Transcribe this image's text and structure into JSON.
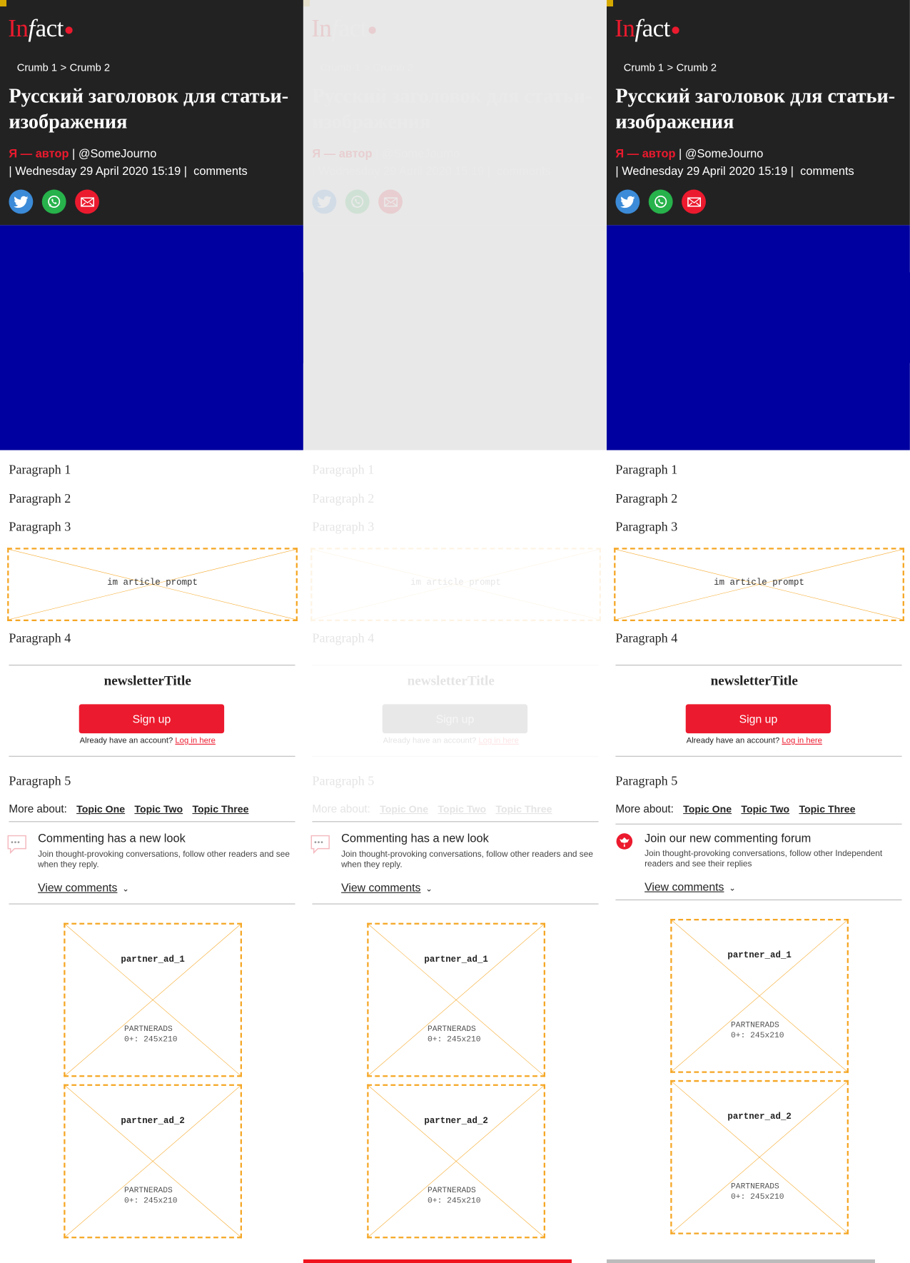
{
  "logo": {
    "in": "In",
    "f": "f",
    "act": "act"
  },
  "breadcrumb": {
    "crumb1": "Crumb 1",
    "sep": ">",
    "crumb2": "Crumb 2"
  },
  "article": {
    "title": "Русский заголовок для статьи-изображения",
    "author": "Я — автор",
    "handle": "@SomeJourno",
    "date": "Wednesday 29 April 2020 15:19",
    "comments_link": "comments",
    "paragraphs": [
      "Paragraph 1",
      "Paragraph 2",
      "Paragraph 3",
      "Paragraph 4",
      "Paragraph 5"
    ]
  },
  "share": {
    "icons": [
      "twitter-icon",
      "whatsapp-icon",
      "email-icon"
    ],
    "colors": {
      "twitter": "#3b8bd8",
      "whatsapp": "#27b24b",
      "email": "#ec1a2e"
    }
  },
  "prompt_slot": {
    "label": "im article prompt"
  },
  "newsletter": {
    "title": "newsletterTitle",
    "signup_label": "Sign up",
    "already": "Already have an account?",
    "login_link": "Log in here"
  },
  "more_about": {
    "label": "More about:",
    "topics": [
      "Topic One",
      "Topic Two",
      "Topic Three"
    ]
  },
  "comments_promo": {
    "variant_a": {
      "title": "Commenting has a new look",
      "desc": "Join thought-provoking conversations, follow other readers and see when they reply.",
      "view": "View comments"
    },
    "variant_b": {
      "title": "Join our new commenting forum",
      "desc": "Join thought-provoking conversations, follow other Independent readers and see their replies",
      "view": "View comments"
    }
  },
  "ads": [
    {
      "name": "partner_ad_1",
      "provider": "PARTNERADS",
      "size": "0+: 245x210"
    },
    {
      "name": "partner_ad_2",
      "provider": "PARTNERADS",
      "size": "0+: 245x210"
    }
  ],
  "colors": {
    "brand": "#ec1a2e",
    "header_bg": "#222222",
    "hero_bg": "#0000a0",
    "placeholder": "#f5a623"
  }
}
